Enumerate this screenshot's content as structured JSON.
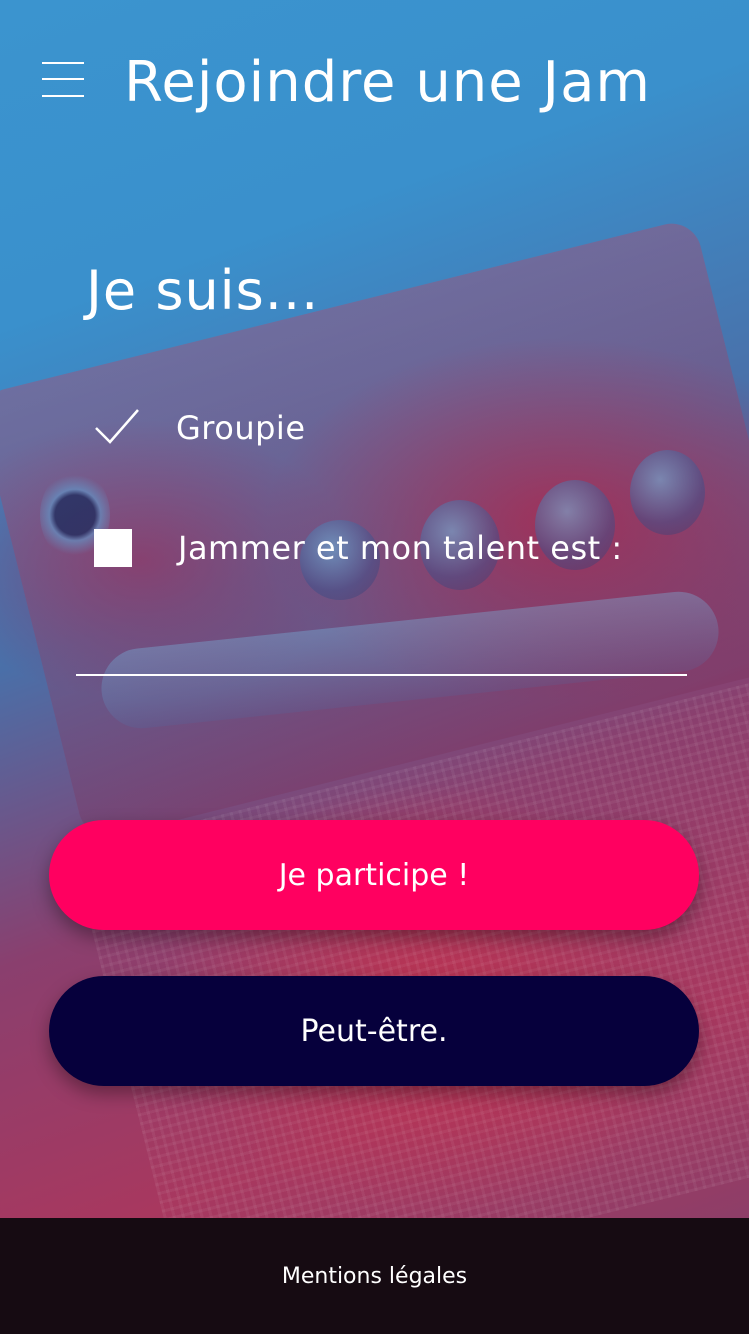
{
  "header": {
    "title": "Rejoindre une Jam",
    "menu_icon": "hamburger-menu-icon"
  },
  "form": {
    "prompt": "Je suis...",
    "options": [
      {
        "label": "Groupie",
        "checked": true,
        "icon": "checkmark-icon"
      },
      {
        "label": "Jammer et mon talent est :",
        "checked": false,
        "icon": "checkbox-icon"
      }
    ],
    "talent_value": ""
  },
  "buttons": {
    "primary_label": "Je participe !",
    "secondary_label": "Peut-être."
  },
  "footer": {
    "link_label": "Mentions légales"
  },
  "colors": {
    "primary_button": "#ff0060",
    "secondary_button": "#06003c",
    "footer_background": "#160b12",
    "text": "#ffffff"
  }
}
